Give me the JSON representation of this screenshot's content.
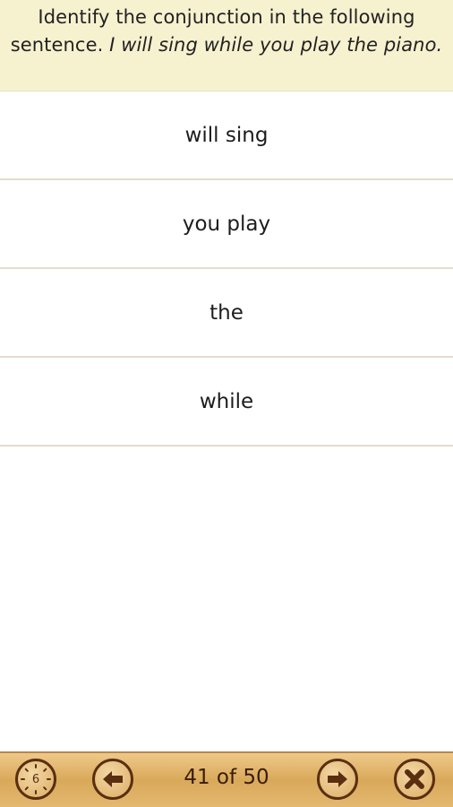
{
  "question": {
    "prefix": "Identify the conjunction in the following sentence. ",
    "sentence": "I will sing while you play the piano."
  },
  "answers": [
    {
      "label": "will sing"
    },
    {
      "label": "you play"
    },
    {
      "label": "the"
    },
    {
      "label": "while"
    }
  ],
  "toolbar": {
    "timer_value": "6",
    "progress_label": "41 of 50",
    "timer_icon": "clock-icon",
    "prev_icon": "arrow-left-icon",
    "next_icon": "arrow-right-icon",
    "close_icon": "close-icon"
  },
  "colors": {
    "question_bg": "#f6f1cf",
    "toolbar_bg": "#d9a95a",
    "icon_color": "#5a2f10",
    "divider": "#e6dccb"
  }
}
